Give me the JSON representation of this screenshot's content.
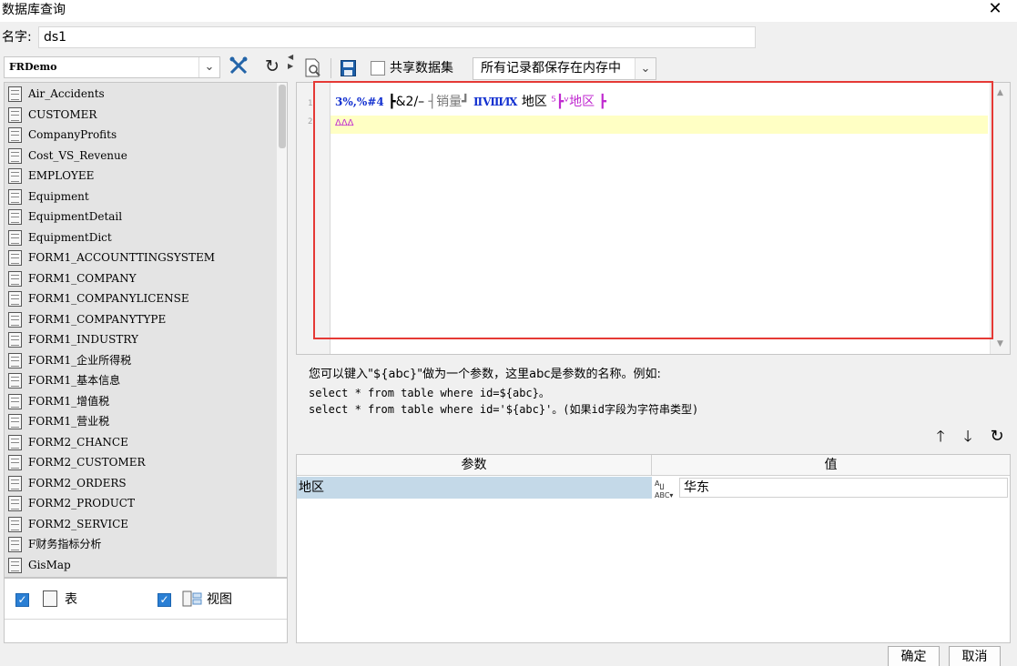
{
  "window": {
    "title": "数据库查询",
    "close_glyph": "✕"
  },
  "name_field": {
    "label": "名字:",
    "value": "ds1"
  },
  "connection": {
    "selected": "FRDemo"
  },
  "tables": [
    "Air_Accidents",
    "CUSTOMER",
    "CompanyProfits",
    "Cost_VS_Revenue",
    "EMPLOYEE",
    "Equipment",
    "EquipmentDetail",
    "EquipmentDict",
    "FORM1_ACCOUNTTINGSYSTEM",
    "FORM1_COMPANY",
    "FORM1_COMPANYLICENSE",
    "FORM1_COMPANYTYPE",
    "FORM1_INDUSTRY",
    "FORM1_企业所得税",
    "FORM1_基本信息",
    "FORM1_增值税",
    "FORM1_营业税",
    "FORM2_CHANCE",
    "FORM2_CUSTOMER",
    "FORM2_ORDERS",
    "FORM2_PRODUCT",
    "FORM2_SERVICE",
    "F财务指标分析",
    "GisMap"
  ],
  "filter": {
    "table_label": "表",
    "view_label": "视图"
  },
  "toolbar": {
    "share_label": "共享数据集",
    "memory_option": "所有记录都保存在内存中"
  },
  "editor": {
    "line_numbers": [
      "1",
      "2"
    ],
    "line1_tokens": [
      "3%,%#4",
      "┣&2/–",
      "┤销量┛",
      "ⅡⅧ⁄Ⅸ",
      "地区",
      "⁵┣ᵛ地区",
      "┣"
    ],
    "line2_text": "ΔΔΔ"
  },
  "hint": {
    "text": "您可以键入\"${abc}\"做为一个参数，这里abc是参数的名称。例如:",
    "example1": "select * from table where id=${abc}。",
    "example2": "select * from table where id='${abc}'。(如果id字段为字符串类型)"
  },
  "params": {
    "col_param": "参数",
    "col_value": "值",
    "rows": [
      {
        "name": "地区",
        "value": "华东",
        "type_icon": "abc-type-icon"
      }
    ]
  },
  "buttons": {
    "ok": "确定",
    "cancel": "取消"
  },
  "colors": {
    "highlight_line": "#ffffc4",
    "selected_row": "#c4d9e8",
    "annotation_box": "#e53935",
    "keyword": "#1230d0",
    "param_token": "#c02ad0"
  }
}
